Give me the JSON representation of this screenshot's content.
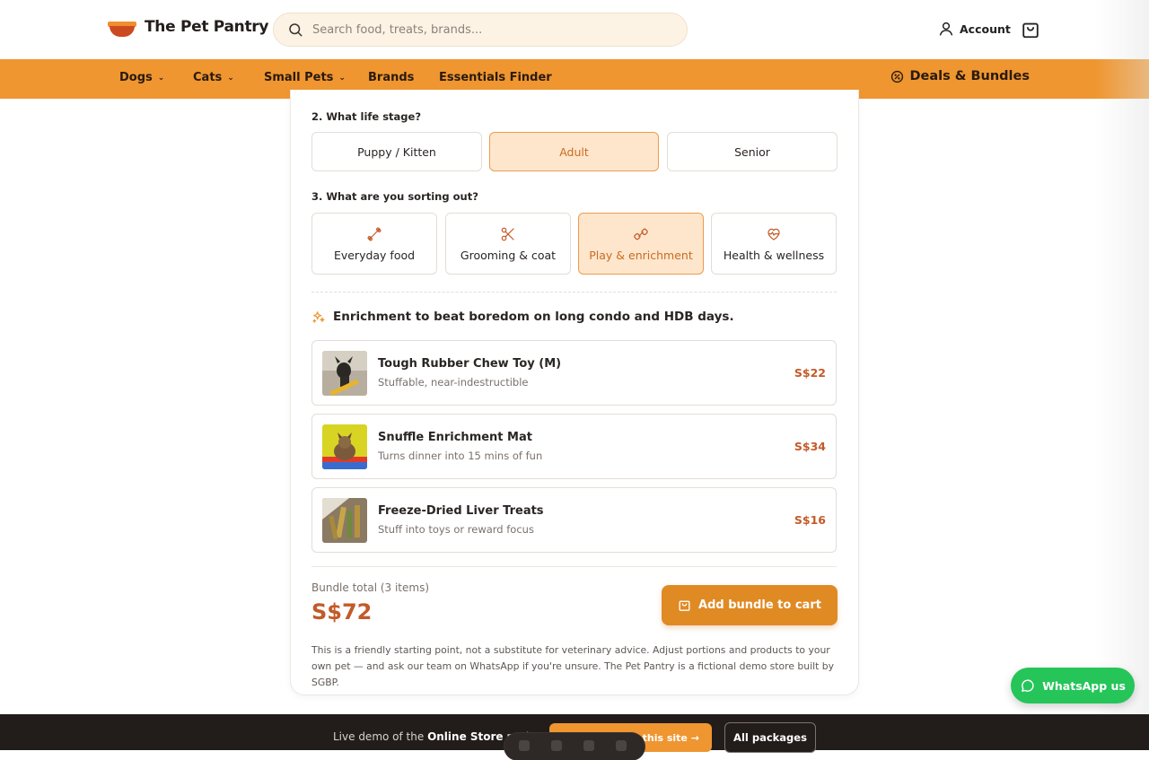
{
  "header": {
    "brand": "The Pet Pantry",
    "search_placeholder": "Search food, treats, brands...",
    "account_label": "Account"
  },
  "nav": {
    "items": [
      {
        "label": "Dogs",
        "has_dropdown": true
      },
      {
        "label": "Cats",
        "has_dropdown": true
      },
      {
        "label": "Small Pets",
        "has_dropdown": true
      },
      {
        "label": "Brands",
        "has_dropdown": false
      },
      {
        "label": "Essentials Finder",
        "has_dropdown": false
      }
    ],
    "deals_label": "Deals & Bundles"
  },
  "finder": {
    "q2_label": "2. What life stage?",
    "life_stages": [
      {
        "label": "Puppy / Kitten",
        "selected": false
      },
      {
        "label": "Adult",
        "selected": true
      },
      {
        "label": "Senior",
        "selected": false
      }
    ],
    "q3_label": "3. What are you sorting out?",
    "topics": [
      {
        "label": "Everyday food",
        "icon": "bone-icon",
        "selected": false
      },
      {
        "label": "Grooming & coat",
        "icon": "scissors-icon",
        "selected": false
      },
      {
        "label": "Play & enrichment",
        "icon": "dog-toy-icon",
        "selected": true
      },
      {
        "label": "Health & wellness",
        "icon": "heart-pulse-icon",
        "selected": false
      }
    ],
    "headline": "Enrichment to beat boredom on long condo and HDB days.",
    "products": [
      {
        "name": "Tough Rubber Chew Toy (M)",
        "desc": "Stuffable, near-indestructible",
        "price": "S$22"
      },
      {
        "name": "Snuffle Enrichment Mat",
        "desc": "Turns dinner into 15 mins of fun",
        "price": "S$34"
      },
      {
        "name": "Freeze-Dried Liver Treats",
        "desc": "Stuff into toys or reward focus",
        "price": "S$16"
      }
    ],
    "bundle_label": "Bundle total (3 items)",
    "bundle_total": "S$72",
    "add_button": "Add bundle to cart",
    "disclaimer": "This is a friendly starting point, not a substitute for veterinary advice. Adjust portions and products to your own pet — and ask our team on WhatsApp if you're unsure. The Pet Pantry is a fictional demo store built by SGBP."
  },
  "whatsapp_label": "WhatsApp us",
  "demo_bar": {
    "text_prefix": "Live demo of the ",
    "text_bold": "Online Store",
    "text_suffix": " packa",
    "buy_label": "Get a site like this site →",
    "packages_label": "All packages"
  },
  "colors": {
    "accent": "#ef9630",
    "price": "#c35a28",
    "selected_bg": "#fde6cc",
    "whatsapp": "#25c55a",
    "demo_bar": "#221c1a"
  }
}
